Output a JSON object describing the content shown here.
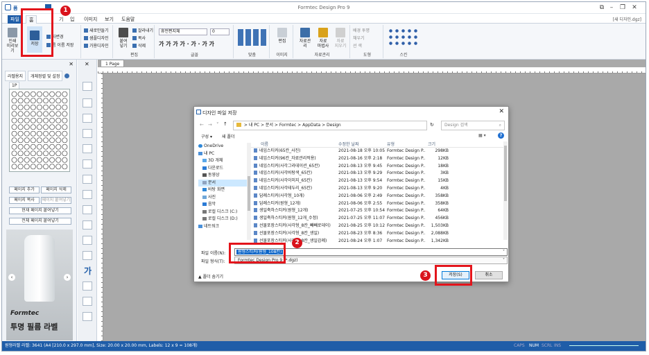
{
  "app": {
    "title": "Formtec Design Pro 9",
    "doc_title": "[새 디자인.dgz]",
    "quick_label": "폼"
  },
  "tabs": [
    "파일",
    "홈",
    "기",
    "입",
    "이미지",
    "보기",
    "도움말"
  ],
  "ribbon": {
    "print_btn": "인쇄\n미리보기",
    "save_btn": "저장",
    "tojpg": "자변경",
    "save_as": "름 이름 저장",
    "new_design": "새로만들기",
    "open_design": "샘플디자인",
    "edit_label": "가용디자인",
    "paste_btn": "붙여\n넣기",
    "cut": "잘라내기",
    "copy": "복사",
    "delete": "삭제",
    "group_edit": "편집",
    "font_name": "휴먼편지체",
    "font_size": "0",
    "font_row": "가 가 가 가 · 가 · 가 가",
    "group_font": "글꼴",
    "group_align": "맞춤",
    "group_image": "이미지",
    "image_edit": "편집",
    "data_mgmt": "자료관리",
    "data_merge": "자료\n마법사",
    "data_clear": "자료\n지우기",
    "group_data": "자료관리",
    "group_shape": "도형",
    "shape_opt1": "배경 투명",
    "shape_opt2": "채우기",
    "shape_opt3": "선 색",
    "group_skin": "스킨"
  },
  "left_panel": {
    "tab1": "라벨용지",
    "tab2": "개체정렬 및 설정",
    "page_tab": "1P",
    "btn_add_page": "페이지 추가",
    "btn_del_page": "페이지 삭제",
    "btn_copy_page": "페이지 복사",
    "btn_paste_page": "페이지 붙여넣기",
    "btn_current_paste": "현재 페이지 붙여넣기",
    "btn_all_paste": "전체 페이지 붙여넣기",
    "promo_brand": "Formtec",
    "promo_text": "투명 필름 라벨"
  },
  "canvas": {
    "page_tab": "1 Page"
  },
  "statusbar": {
    "info": "원형라벨 라벨: 3641 (A4 [210.0 x 297.0 mm], Size: 20.00 x 20.00 mm, Labels: 12 x 9 = 108개)",
    "caps": "CAPS",
    "num": "NUM",
    "scrl": "SCRL",
    "ins": "INS"
  },
  "dialog": {
    "title": "디자인 파일 저장",
    "path": "> 내 PC > 문서 > Formtec > AppData > Design",
    "search_placeholder": "Design 검색",
    "organize": "구성 ▾",
    "new_folder": "새 폴더",
    "nav_items": [
      "OneDrive",
      "내 PC",
      "3D 개체",
      "다운로드",
      "동영상",
      "문서",
      "바탕 화면",
      "사진",
      "음악",
      "로컬 디스크 (C:)",
      "로컬 디스크 (D:)",
      "네트워크"
    ],
    "columns": [
      "이름",
      "수정한 날짜",
      "유형",
      "크기"
    ],
    "files": [
      {
        "name": "네임스티커(65칸_사진)",
        "date": "2021-08-18 오후 10:05",
        "type": "Formtec Design P...",
        "size": "298KB"
      },
      {
        "name": "네임스티커(96칸_자료관리적용)",
        "date": "2021-08-16 오후 2:18",
        "type": "Formtec Design P...",
        "size": "12KB"
      },
      {
        "name": "네임스티커(사각그라데이션_65칸)",
        "date": "2021-08-13 오후 9:45",
        "type": "Formtec Design P...",
        "size": "18KB"
      },
      {
        "name": "네임스티커(사각바탕색_65칸)",
        "date": "2021-08-13 오후 9:29",
        "type": "Formtec Design P...",
        "size": "3KB"
      },
      {
        "name": "네임스티커(사각이미지_65칸)",
        "date": "2021-08-13 오후 9:54",
        "type": "Formtec Design P...",
        "size": "15KB"
      },
      {
        "name": "네임스티커(사각테두리_65칸)",
        "date": "2021-08-13 오후 9:20",
        "type": "Formtec Design P...",
        "size": "4KB"
      },
      {
        "name": "답례스티커(사각형_10개)",
        "date": "2021-08-06 오후 2:49",
        "type": "Formtec Design P...",
        "size": "358KB"
      },
      {
        "name": "답례스티커(원형_12개)",
        "date": "2021-08-06 오후 2:55",
        "type": "Formtec Design P...",
        "size": "358KB"
      },
      {
        "name": "생일축하스티커(원형_12개)",
        "date": "2021-07-25 오후 10:54",
        "type": "Formtec Design P...",
        "size": "64KB"
      },
      {
        "name": "생일축하스티커(원형_12개_수정)",
        "date": "2021-07-25 오후 11:07",
        "type": "Formtec Design P...",
        "size": "456KB"
      },
      {
        "name": "선물포장스티커(사각형_8칸_빼빼로데이)",
        "date": "2021-08-25 오후 10:12",
        "type": "Formtec Design P...",
        "size": "1,503KB"
      },
      {
        "name": "선물포장스티커(사각형_8칸_생일)",
        "date": "2021-08-23 오후 8:36",
        "type": "Formtec Design P...",
        "size": "2,088KB"
      },
      {
        "name": "선물포장스티커(사각형_8칸_생일감례)",
        "date": "2021-08-24 오후 1:07",
        "type": "Formtec Design P...",
        "size": "1,342KB"
      }
    ],
    "filename_label": "파일 이름(N):",
    "filename_value": "원형스티커(원형_108칸)",
    "filetype_label": "파일 형식(T):",
    "filetype_value": "Formtec Design Pro 9 (*.dgz)",
    "hide_folders": "▲ 폴더 숨기기",
    "save_button": "저장(S)",
    "cancel_button": "취소"
  },
  "annotations": [
    "1",
    "2",
    "3"
  ],
  "colors": {
    "accent": "#1f5da8",
    "highlight": "#e3141b",
    "selection": "#0a64c8"
  }
}
